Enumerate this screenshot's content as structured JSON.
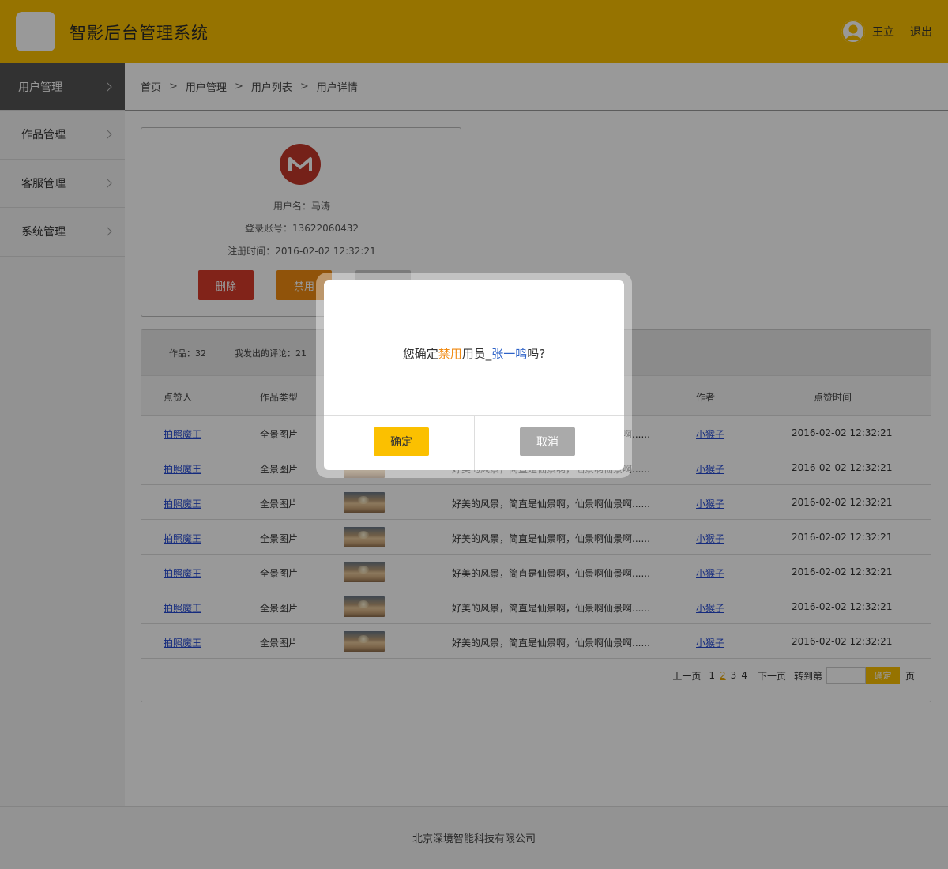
{
  "header": {
    "app_title": "智影后台管理系统",
    "user_name": "王立",
    "logout_label": "退出"
  },
  "sidebar": {
    "items": [
      {
        "label": "用户管理",
        "active": true
      },
      {
        "label": "作品管理"
      },
      {
        "label": "客服管理"
      },
      {
        "label": "系统管理"
      }
    ]
  },
  "breadcrumb": {
    "items": [
      "首页",
      "用户管理",
      "用户列表",
      "用户详情"
    ],
    "separator": ">"
  },
  "profile": {
    "username_line": "用户名：马涛",
    "account_line": "登录账号：13622060432",
    "reg_label": "注册时间：",
    "reg_time": "2016-02-02  12:32:21",
    "delete_label": "删除",
    "disable_label": "禁用"
  },
  "stats": {
    "works": "作品：32",
    "comments": "我发出的评论：21"
  },
  "table": {
    "headers": [
      "点赞人",
      "作品类型",
      "作者",
      "点赞时间"
    ],
    "rows": [
      {
        "liker": "拍照魔王",
        "type": "全景图片",
        "desc": "好美的风景，简直是仙景啊，仙景啊仙景啊......",
        "author": "小猴子",
        "time": "2016-02-02  12:32:21"
      },
      {
        "liker": "拍照魔王",
        "type": "全景图片",
        "desc": "好美的风景，简直是仙景啊，仙景啊仙景啊......",
        "author": "小猴子",
        "time": "2016-02-02  12:32:21"
      },
      {
        "liker": "拍照魔王",
        "type": "全景图片",
        "desc": "好美的风景，简直是仙景啊，仙景啊仙景啊......",
        "author": "小猴子",
        "time": "2016-02-02  12:32:21"
      },
      {
        "liker": "拍照魔王",
        "type": "全景图片",
        "desc": "好美的风景，简直是仙景啊，仙景啊仙景啊......",
        "author": "小猴子",
        "time": "2016-02-02  12:32:21"
      },
      {
        "liker": "拍照魔王",
        "type": "全景图片",
        "desc": "好美的风景，简直是仙景啊，仙景啊仙景啊......",
        "author": "小猴子",
        "time": "2016-02-02  12:32:21"
      },
      {
        "liker": "拍照魔王",
        "type": "全景图片",
        "desc": "好美的风景，简直是仙景啊，仙景啊仙景啊......",
        "author": "小猴子",
        "time": "2016-02-02  12:32:21"
      },
      {
        "liker": "拍照魔王",
        "type": "全景图片",
        "desc": "好美的风景，简直是仙景啊，仙景啊仙景啊......",
        "author": "小猴子",
        "time": "2016-02-02  12:32:21"
      }
    ]
  },
  "pager": {
    "prev_label": "上一页",
    "pages": [
      "1",
      "2",
      "3",
      "4"
    ],
    "current_page": "2",
    "next_label": "下一页",
    "jump_label": "转到第",
    "jump_value": "",
    "jump_button": "确定",
    "page_unit": "页"
  },
  "footer": {
    "company": "北京深境智能科技有限公司"
  },
  "dialog": {
    "msg_prefix": "您确定",
    "msg_action": "禁用",
    "msg_middle": "用员_",
    "msg_name": "张一鸣",
    "msg_suffix": "吗?",
    "confirm_label": "确定",
    "cancel_label": "取消"
  },
  "colors": {
    "brand_yellow": "#fbc000",
    "sidebar_active": "#545454",
    "delete_red": "#d83b2b",
    "disable_orange": "#f08a12",
    "link_blue": "#2349d3"
  }
}
